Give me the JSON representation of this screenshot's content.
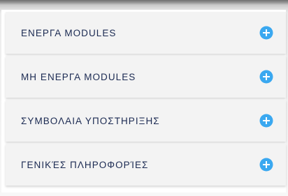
{
  "accordion": {
    "items": [
      {
        "label": "ΕΝΕΡΓΑ MODULES",
        "icon": "plus-circle-icon"
      },
      {
        "label": "ΜΗ ΕΝΕΡΓΑ MODULES",
        "icon": "plus-circle-icon"
      },
      {
        "label": "ΣΥΜΒΟΛΑΙΑ ΥΠΟΣΤΗΡΙΞΗΣ",
        "icon": "plus-circle-icon"
      },
      {
        "label": "ΓΕΝΙΚΈΣ ΠΛΗΡΟΦΟΡΊΕΣ",
        "icon": "plus-circle-icon"
      }
    ]
  },
  "colors": {
    "label_text": "#1b2a52",
    "icon_accent": "#3aa8f0",
    "item_background": "#f3f3f3"
  }
}
